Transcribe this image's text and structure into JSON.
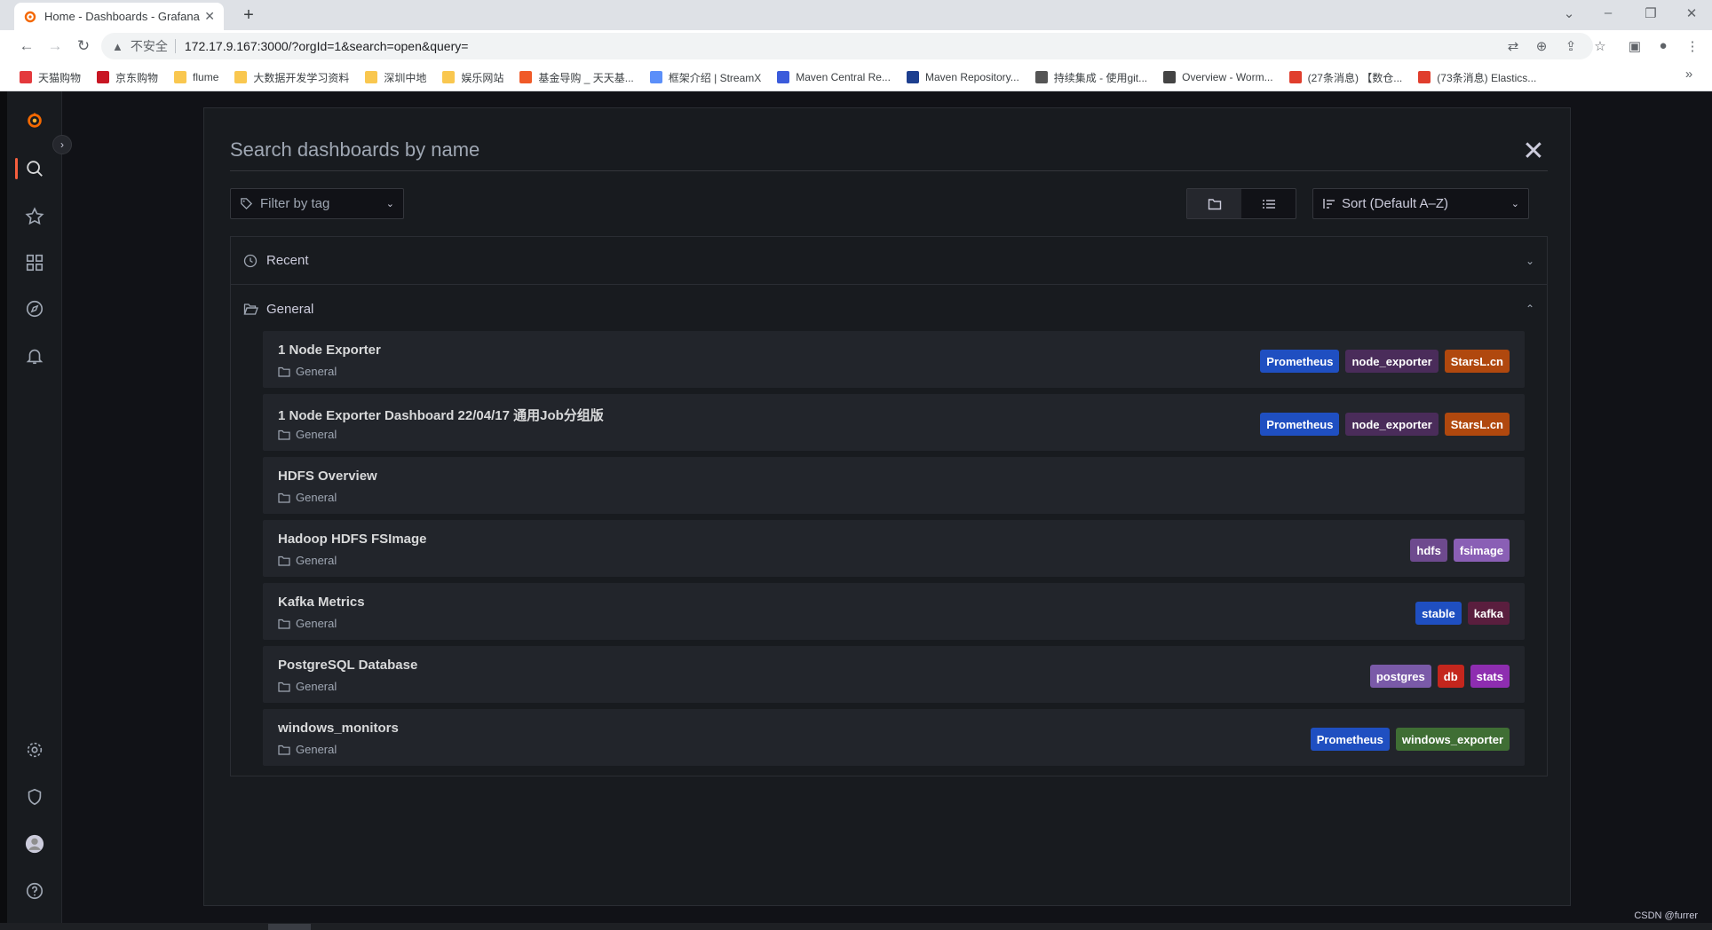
{
  "browser": {
    "tab_title": "Home - Dashboards - Grafana",
    "tab_close": "✕",
    "new_tab": "+",
    "security_label": "不安全",
    "url": "172.17.9.167:3000/?orgId=1&search=open&query=",
    "bookmarks": [
      {
        "label": "天猫购物",
        "color": "#e4393c"
      },
      {
        "label": "京东购物",
        "color": "#c81623"
      },
      {
        "label": "flume",
        "color": "#f9c74f"
      },
      {
        "label": "大数据开发学习资料",
        "color": "#f9c74f"
      },
      {
        "label": "深圳中地",
        "color": "#f9c74f"
      },
      {
        "label": "娱乐网站",
        "color": "#f9c74f"
      },
      {
        "label": "基金导购 _ 天天基...",
        "color": "#f05a28"
      },
      {
        "label": "框架介绍 | StreamX",
        "color": "#5b8ff9"
      },
      {
        "label": "Maven Central Re...",
        "color": "#3b5bdb"
      },
      {
        "label": "Maven Repository...",
        "color": "#1d3f8f"
      },
      {
        "label": "持续集成 - 使用git...",
        "color": "#555555"
      },
      {
        "label": "Overview - Worm...",
        "color": "#444444"
      },
      {
        "label": "(27条消息) 【数仓...",
        "color": "#e03e2d"
      },
      {
        "label": "(73条消息) Elastics...",
        "color": "#e03e2d"
      }
    ],
    "more_bookmarks": "»"
  },
  "search": {
    "placeholder": "Search dashboards by name",
    "close": "✕",
    "filter_placeholder": "Filter by tag",
    "sort_label": "Sort (Default A–Z)"
  },
  "sections": {
    "recent": "Recent",
    "general": "General"
  },
  "dashboards": [
    {
      "title": "1 Node Exporter",
      "folder": "General",
      "tags": [
        {
          "label": "Prometheus",
          "color": "#1f4fc1"
        },
        {
          "label": "node_exporter",
          "color": "#4a2c5a"
        },
        {
          "label": "StarsL.cn",
          "color": "#b0480e"
        }
      ]
    },
    {
      "title": "1 Node Exporter Dashboard 22/04/17 通用Job分组版",
      "folder": "General",
      "tags": [
        {
          "label": "Prometheus",
          "color": "#1f4fc1"
        },
        {
          "label": "node_exporter",
          "color": "#4a2c5a"
        },
        {
          "label": "StarsL.cn",
          "color": "#b0480e"
        }
      ]
    },
    {
      "title": "HDFS Overview",
      "folder": "General",
      "tags": []
    },
    {
      "title": "Hadoop HDFS FSImage",
      "folder": "General",
      "tags": [
        {
          "label": "hdfs",
          "color": "#6e4a8e"
        },
        {
          "label": "fsimage",
          "color": "#8a5fb5"
        }
      ]
    },
    {
      "title": "Kafka Metrics",
      "folder": "General",
      "tags": [
        {
          "label": "stable",
          "color": "#1f4fc1"
        },
        {
          "label": "kafka",
          "color": "#5a1e3e"
        }
      ]
    },
    {
      "title": "PostgreSQL Database",
      "folder": "General",
      "tags": [
        {
          "label": "postgres",
          "color": "#7a5aa8"
        },
        {
          "label": "db",
          "color": "#c4261d"
        },
        {
          "label": "stats",
          "color": "#8e2db0"
        }
      ]
    },
    {
      "title": "windows_monitors",
      "folder": "General",
      "tags": [
        {
          "label": "Prometheus",
          "color": "#1f4fc1"
        },
        {
          "label": "windows_exporter",
          "color": "#3f6e34"
        }
      ]
    }
  ],
  "watermark": "CSDN @furrer"
}
